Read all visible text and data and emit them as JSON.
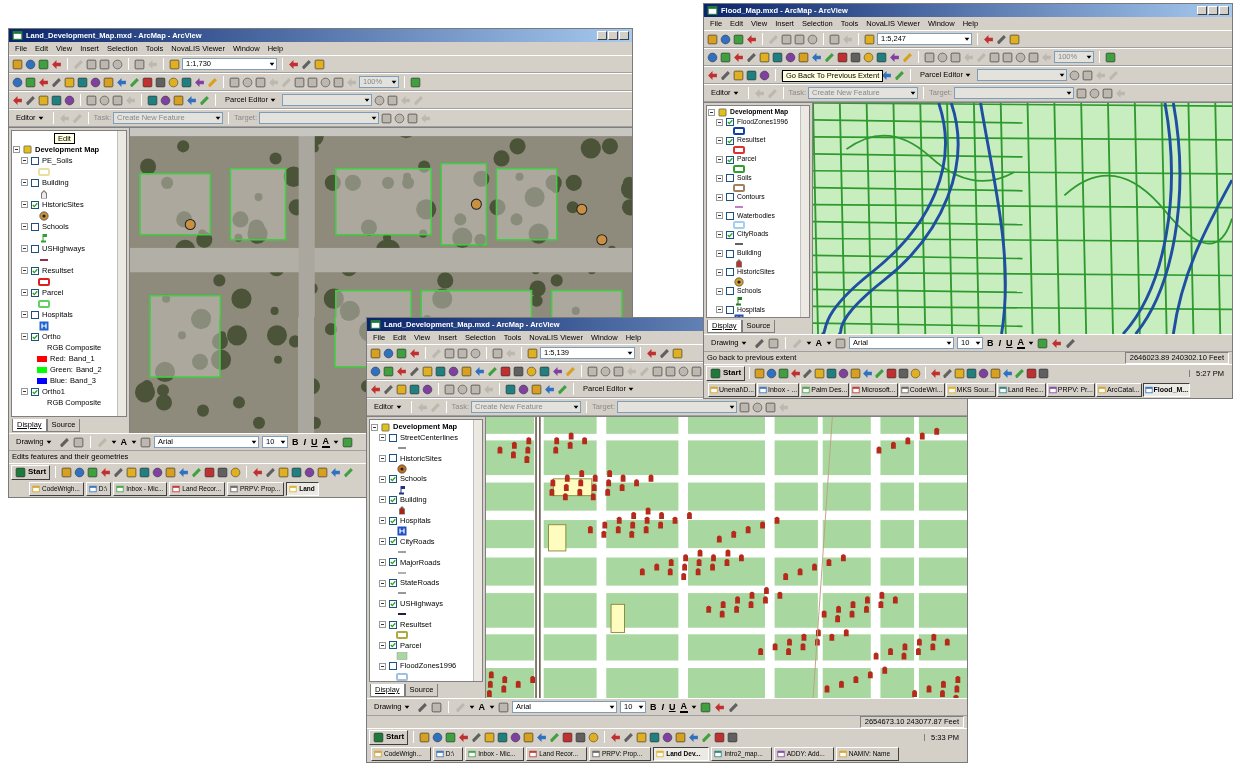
{
  "windows": [
    {
      "kind": "aerial",
      "title": "Land_Development_Map.mxd - ArcMap - ArcView",
      "menu": [
        "File",
        "Edit",
        "View",
        "Insert",
        "Selection",
        "Tools",
        "NovaLIS Viewer",
        "Window",
        "Help"
      ],
      "toolbar": {
        "scale": "1:1,730",
        "zoom_percent": "100%",
        "parcel_editor": "Parcel Editor",
        "editor": "Editor",
        "task_label": "Task:",
        "task": "Create New Feature",
        "target_label": "Target:"
      },
      "toc": {
        "tooltip": "Edit",
        "root": "Development Map",
        "layers": [
          {
            "name": "PE_Soils",
            "checked": false,
            "kind": "polygon",
            "color": "#e8e0a0"
          },
          {
            "name": "Building",
            "checked": false,
            "kind": "building",
            "color": "#ececec"
          },
          {
            "name": "HistoricSites",
            "checked": true,
            "kind": "site",
            "color": "#c89040"
          },
          {
            "name": "Schools",
            "checked": false,
            "kind": "school",
            "color": "#30a030"
          },
          {
            "name": "USHighways",
            "checked": false,
            "kind": "line",
            "color": "#903050"
          },
          {
            "name": "Resultset",
            "checked": true,
            "kind": "polygon",
            "color": "#e02020"
          },
          {
            "name": "Parcel",
            "checked": true,
            "kind": "polygon",
            "color": "#60d060"
          },
          {
            "name": "Hospitals",
            "checked": false,
            "kind": "hospital",
            "color": "#2060d0"
          },
          {
            "name": "Ortho",
            "checked": true,
            "kind": "raster",
            "composite": "RGB Composite",
            "bands": [
              {
                "label": "Red:",
                "value": "Band_1",
                "color": "#ff0000"
              },
              {
                "label": "Green:",
                "value": "Band_2",
                "color": "#00ff00"
              },
              {
                "label": "Blue:",
                "value": "Band_3",
                "color": "#0000ff"
              }
            ]
          },
          {
            "name": "Ortho1",
            "checked": true,
            "kind": "raster",
            "composite": "RGB Composite"
          }
        ],
        "tabs": [
          {
            "label": "Display",
            "selected": true
          },
          {
            "label": "Source",
            "selected": false
          }
        ]
      },
      "drawing": {
        "label": "Drawing",
        "text_tool": "A",
        "font": "Arial",
        "size": "10",
        "bold": "B",
        "italic": "I",
        "underline": "U",
        "font_color": "A"
      },
      "status": {
        "message": "Edits features and their geometries"
      },
      "taskbar": {
        "start": "Start",
        "buttons": [
          {
            "label": "CodeWrigh...",
            "selected": false
          },
          {
            "label": "D:\\",
            "selected": false
          },
          {
            "label": "Inbox - Mic...",
            "selected": false
          },
          {
            "label": "Land Recor...",
            "selected": false
          },
          {
            "label": "PRPV: Prop...",
            "selected": false
          },
          {
            "label": "Land",
            "selected": true
          }
        ]
      }
    },
    {
      "kind": "parcels",
      "title": "Land_Development_Map.mxd - ArcMap - ArcView",
      "menu": [
        "File",
        "Edit",
        "View",
        "Insert",
        "Selection",
        "Tools",
        "NovaLIS Viewer",
        "Window",
        "Help"
      ],
      "toolbar": {
        "scale": "1:5,139",
        "parcel_editor": "Parcel Editor",
        "editor": "Editor",
        "task_label": "Task:",
        "task": "Create New Feature",
        "target_label": "Target:"
      },
      "toc": {
        "root": "Development Map",
        "layers": [
          {
            "name": "StreetCenterlines",
            "checked": false,
            "kind": "line",
            "color": "#909090"
          },
          {
            "name": "HistoricSites",
            "checked": false,
            "kind": "site",
            "color": "#c07020"
          },
          {
            "name": "Schools",
            "checked": true,
            "kind": "school",
            "color": "#203080"
          },
          {
            "name": "Building",
            "checked": true,
            "kind": "building",
            "color": "#b02010"
          },
          {
            "name": "Hospitals",
            "checked": true,
            "kind": "hospital",
            "color": "#2050c0"
          },
          {
            "name": "CityRoads",
            "checked": true,
            "kind": "line",
            "color": "#a0a0a0"
          },
          {
            "name": "MajorRoads",
            "checked": true,
            "kind": "line",
            "color": "#b0b0b0"
          },
          {
            "name": "StateRoads",
            "checked": true,
            "kind": "line",
            "color": "#989898"
          },
          {
            "name": "USHighways",
            "checked": true,
            "kind": "line",
            "color": "#202040"
          },
          {
            "name": "Resultset",
            "checked": true,
            "kind": "polygon",
            "color": "#b0a840"
          },
          {
            "name": "Parcel",
            "checked": true,
            "kind": "fill",
            "color": "#a8d8a0"
          },
          {
            "name": "FloodZones1996",
            "checked": false,
            "kind": "polygon",
            "color": "#a0c0e0"
          }
        ],
        "tabs": [
          {
            "label": "Display",
            "selected": true
          },
          {
            "label": "Source",
            "selected": false
          }
        ]
      },
      "drawing": {
        "label": "Drawing",
        "text_tool": "A",
        "font": "Arial",
        "size": "10",
        "bold": "B",
        "italic": "I",
        "underline": "U",
        "font_color": "A"
      },
      "status": {
        "coords": "2654673.10  243077.87 Feet"
      },
      "taskbar": {
        "start": "Start",
        "clock": "5:33 PM",
        "buttons": [
          {
            "label": "CodeWrigh...",
            "selected": false
          },
          {
            "label": "D:\\",
            "selected": false
          },
          {
            "label": "Inbox - Mic...",
            "selected": false
          },
          {
            "label": "Land Recor...",
            "selected": false
          },
          {
            "label": "PRPV: Prop...",
            "selected": false
          },
          {
            "label": "Land Dev...",
            "selected": true
          },
          {
            "label": "Intro2_map...",
            "selected": false
          },
          {
            "label": "ADDY: Add...",
            "selected": false
          },
          {
            "label": "NAMIV: Name",
            "selected": false
          }
        ]
      }
    },
    {
      "kind": "flood",
      "title": "Flood_Map.mxd - ArcMap - ArcView",
      "menu": [
        "File",
        "Edit",
        "View",
        "Insert",
        "Selection",
        "Tools",
        "NovaLIS Viewer",
        "Window",
        "Help"
      ],
      "toolbar": {
        "scale": "1:5,247",
        "zoom_percent": "100%",
        "tooltip": "Go Back To Previous Extent",
        "parcel_editor": "Parcel Editor",
        "editor": "Editor",
        "task_label": "Task:",
        "task": "Create New Feature",
        "target_label": "Target:"
      },
      "toc": {
        "root": "Development Map",
        "layers": [
          {
            "name": "FloodZones1996",
            "checked": true,
            "kind": "polygon",
            "color": "#1040a0"
          },
          {
            "name": "Resultset",
            "checked": true,
            "kind": "polygon",
            "color": "#e03030"
          },
          {
            "name": "Parcel",
            "checked": true,
            "kind": "polygon",
            "color": "#30a030"
          },
          {
            "name": "Soils",
            "checked": false,
            "kind": "polygon",
            "color": "#a08060"
          },
          {
            "name": "Contours",
            "checked": false,
            "kind": "line",
            "color": "#c080c0"
          },
          {
            "name": "Waterbodies",
            "checked": false,
            "kind": "polygon",
            "color": "#a0d0f0"
          },
          {
            "name": "CityRoads",
            "checked": true,
            "kind": "line",
            "color": "#606060"
          },
          {
            "name": "Building",
            "checked": false,
            "kind": "building",
            "color": "#c03020"
          },
          {
            "name": "HistoricSites",
            "checked": false,
            "kind": "site",
            "color": "#d0a030"
          },
          {
            "name": "Schools",
            "checked": false,
            "kind": "school",
            "color": "#208020"
          },
          {
            "name": "Hospitals",
            "checked": false,
            "kind": "hospital",
            "color": "#2050c0"
          }
        ],
        "tabs": [
          {
            "label": "Display",
            "selected": true
          },
          {
            "label": "Source",
            "selected": false
          }
        ]
      },
      "drawing": {
        "label": "Drawing",
        "text_tool": "A",
        "font": "Arial",
        "size": "10",
        "bold": "B",
        "italic": "I",
        "underline": "U",
        "font_color": "A"
      },
      "status": {
        "message": "Go back to previous extent",
        "coords": "2646023.89  240302.10 Feet"
      },
      "taskbar": {
        "start": "Start",
        "clock": "5:27 PM",
        "buttons": [
          {
            "label": "Unenal\\D...",
            "selected": false
          },
          {
            "label": "Inbox - ...",
            "selected": false
          },
          {
            "label": "Palm Des...",
            "selected": false
          },
          {
            "label": "Microsoft...",
            "selected": false
          },
          {
            "label": "CodeWri...",
            "selected": false
          },
          {
            "label": "MKS Sour...",
            "selected": false
          },
          {
            "label": "Land Rec...",
            "selected": false
          },
          {
            "label": "PRPV: Pr...",
            "selected": false
          },
          {
            "label": "ArcCatal...",
            "selected": false
          },
          {
            "label": "Flood_M...",
            "selected": true
          }
        ]
      }
    }
  ]
}
